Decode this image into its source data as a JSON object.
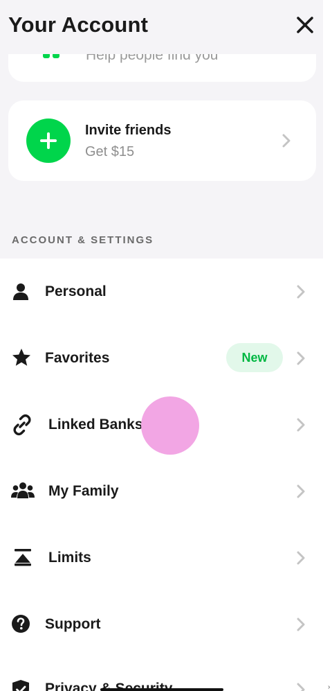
{
  "header": {
    "title": "Your Account",
    "close_icon": "close-icon"
  },
  "cards": {
    "top_peek_text": "Help people find you",
    "invite": {
      "title": "Invite friends",
      "subtitle": "Get $15",
      "icon": "plus-icon"
    }
  },
  "section": {
    "label": "ACCOUNT & SETTINGS"
  },
  "settings": {
    "items": [
      {
        "label": "Personal",
        "icon": "person-icon"
      },
      {
        "label": "Favorites",
        "icon": "star-icon",
        "badge": "New"
      },
      {
        "label": "Linked Banks",
        "icon": "link-icon"
      },
      {
        "label": "My Family",
        "icon": "family-icon"
      },
      {
        "label": "Limits",
        "icon": "limits-icon"
      },
      {
        "label": "Support",
        "icon": "help-icon"
      },
      {
        "label": "Privacy & Security",
        "icon": "shield-check-icon"
      }
    ]
  },
  "colors": {
    "brand_green": "#00d54b",
    "badge_bg": "#e2f8ea",
    "badge_text": "#00b843",
    "touch_indicator": "#f2a6e4"
  },
  "edge_mark": "›"
}
